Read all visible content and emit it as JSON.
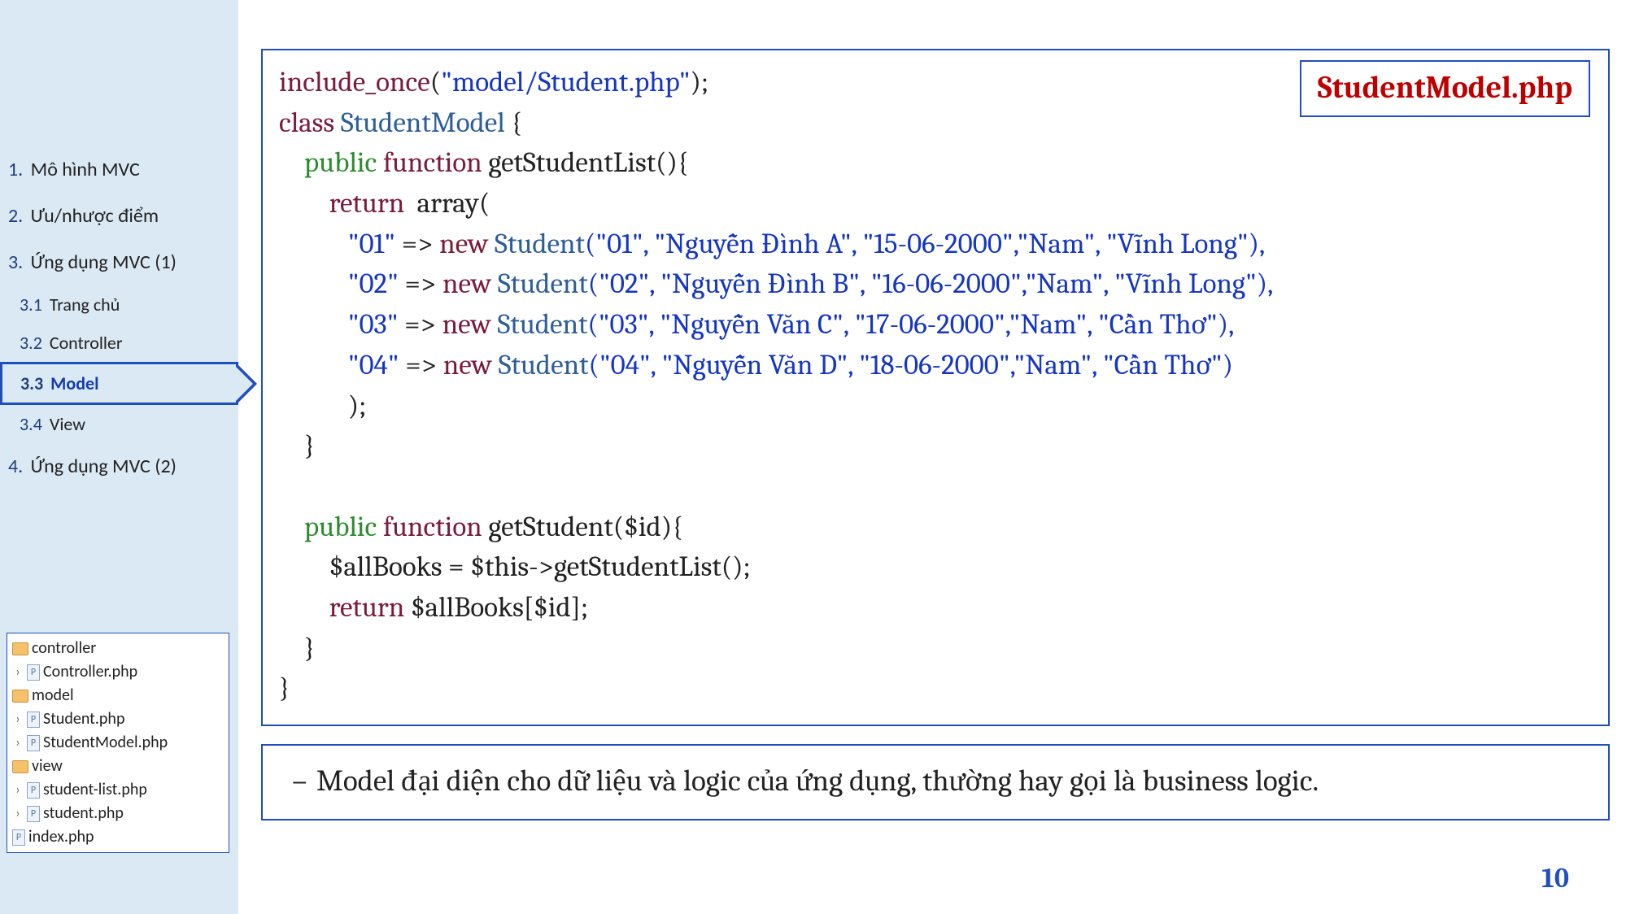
{
  "sidebar": {
    "nav": [
      {
        "num": "1.",
        "label": "Mô hình MVC"
      },
      {
        "num": "2.",
        "label": "Ưu/nhược điểm"
      },
      {
        "num": "3.",
        "label": "Ứng dụng MVC (1)"
      },
      {
        "num": "4.",
        "label": "Ứng dụng MVC (2)"
      }
    ],
    "sub": [
      {
        "num": "3.1",
        "label": "Trang chủ"
      },
      {
        "num": "3.2",
        "label": "Controller"
      },
      {
        "num": "3.3",
        "label": "Model"
      },
      {
        "num": "3.4",
        "label": "View"
      }
    ],
    "tree": {
      "folders": [
        {
          "name": "controller",
          "files": [
            "Controller.php"
          ]
        },
        {
          "name": "model",
          "files": [
            "Student.php",
            "StudentModel.php"
          ]
        },
        {
          "name": "view",
          "files": [
            "student-list.php",
            "student.php"
          ]
        }
      ],
      "root_files": [
        "index.php"
      ]
    }
  },
  "code": {
    "filename": "StudentModel.php",
    "tokens": {
      "include_once": "include_once",
      "inc_path": "\"model/Student.php\"",
      "class_kw": "class",
      "class_name": "StudentModel",
      "public": "public",
      "function": "function",
      "fn1": "getStudentList",
      "return": "return",
      "array_kw": "array",
      "new": "new",
      "student_cls": "Student",
      "rows": [
        {
          "key": "\"01\"",
          "args": "(\"01\", \"Nguyễn Đình A\", \"15-06-2000\",\"Nam\", \"Vĩnh Long\"),"
        },
        {
          "key": "\"02\"",
          "args": "(\"02\", \"Nguyễn Đình B\", \"16-06-2000\",\"Nam\", \"Vĩnh Long\"),"
        },
        {
          "key": "\"03\"",
          "args": "(\"03\", \"Nguyễn Văn C\", \"17-06-2000\",\"Nam\", \"Cần Thơ\"),"
        },
        {
          "key": "\"04\"",
          "args": "(\"04\", \"Nguyễn Văn D\", \"18-06-2000\",\"Nam\", \"Cần Thơ\")"
        }
      ],
      "fn2": "getStudent",
      "fn2_param": "($id)",
      "body2_l1": "$allBooks = $this->getStudentList();",
      "body2_l2_ret": "return",
      "body2_l2_rest": " $allBooks[$id];"
    }
  },
  "note": "Model đại diện cho dữ liệu và logic của ứng dụng, thường hay gọi là business logic.",
  "page_number": "10"
}
